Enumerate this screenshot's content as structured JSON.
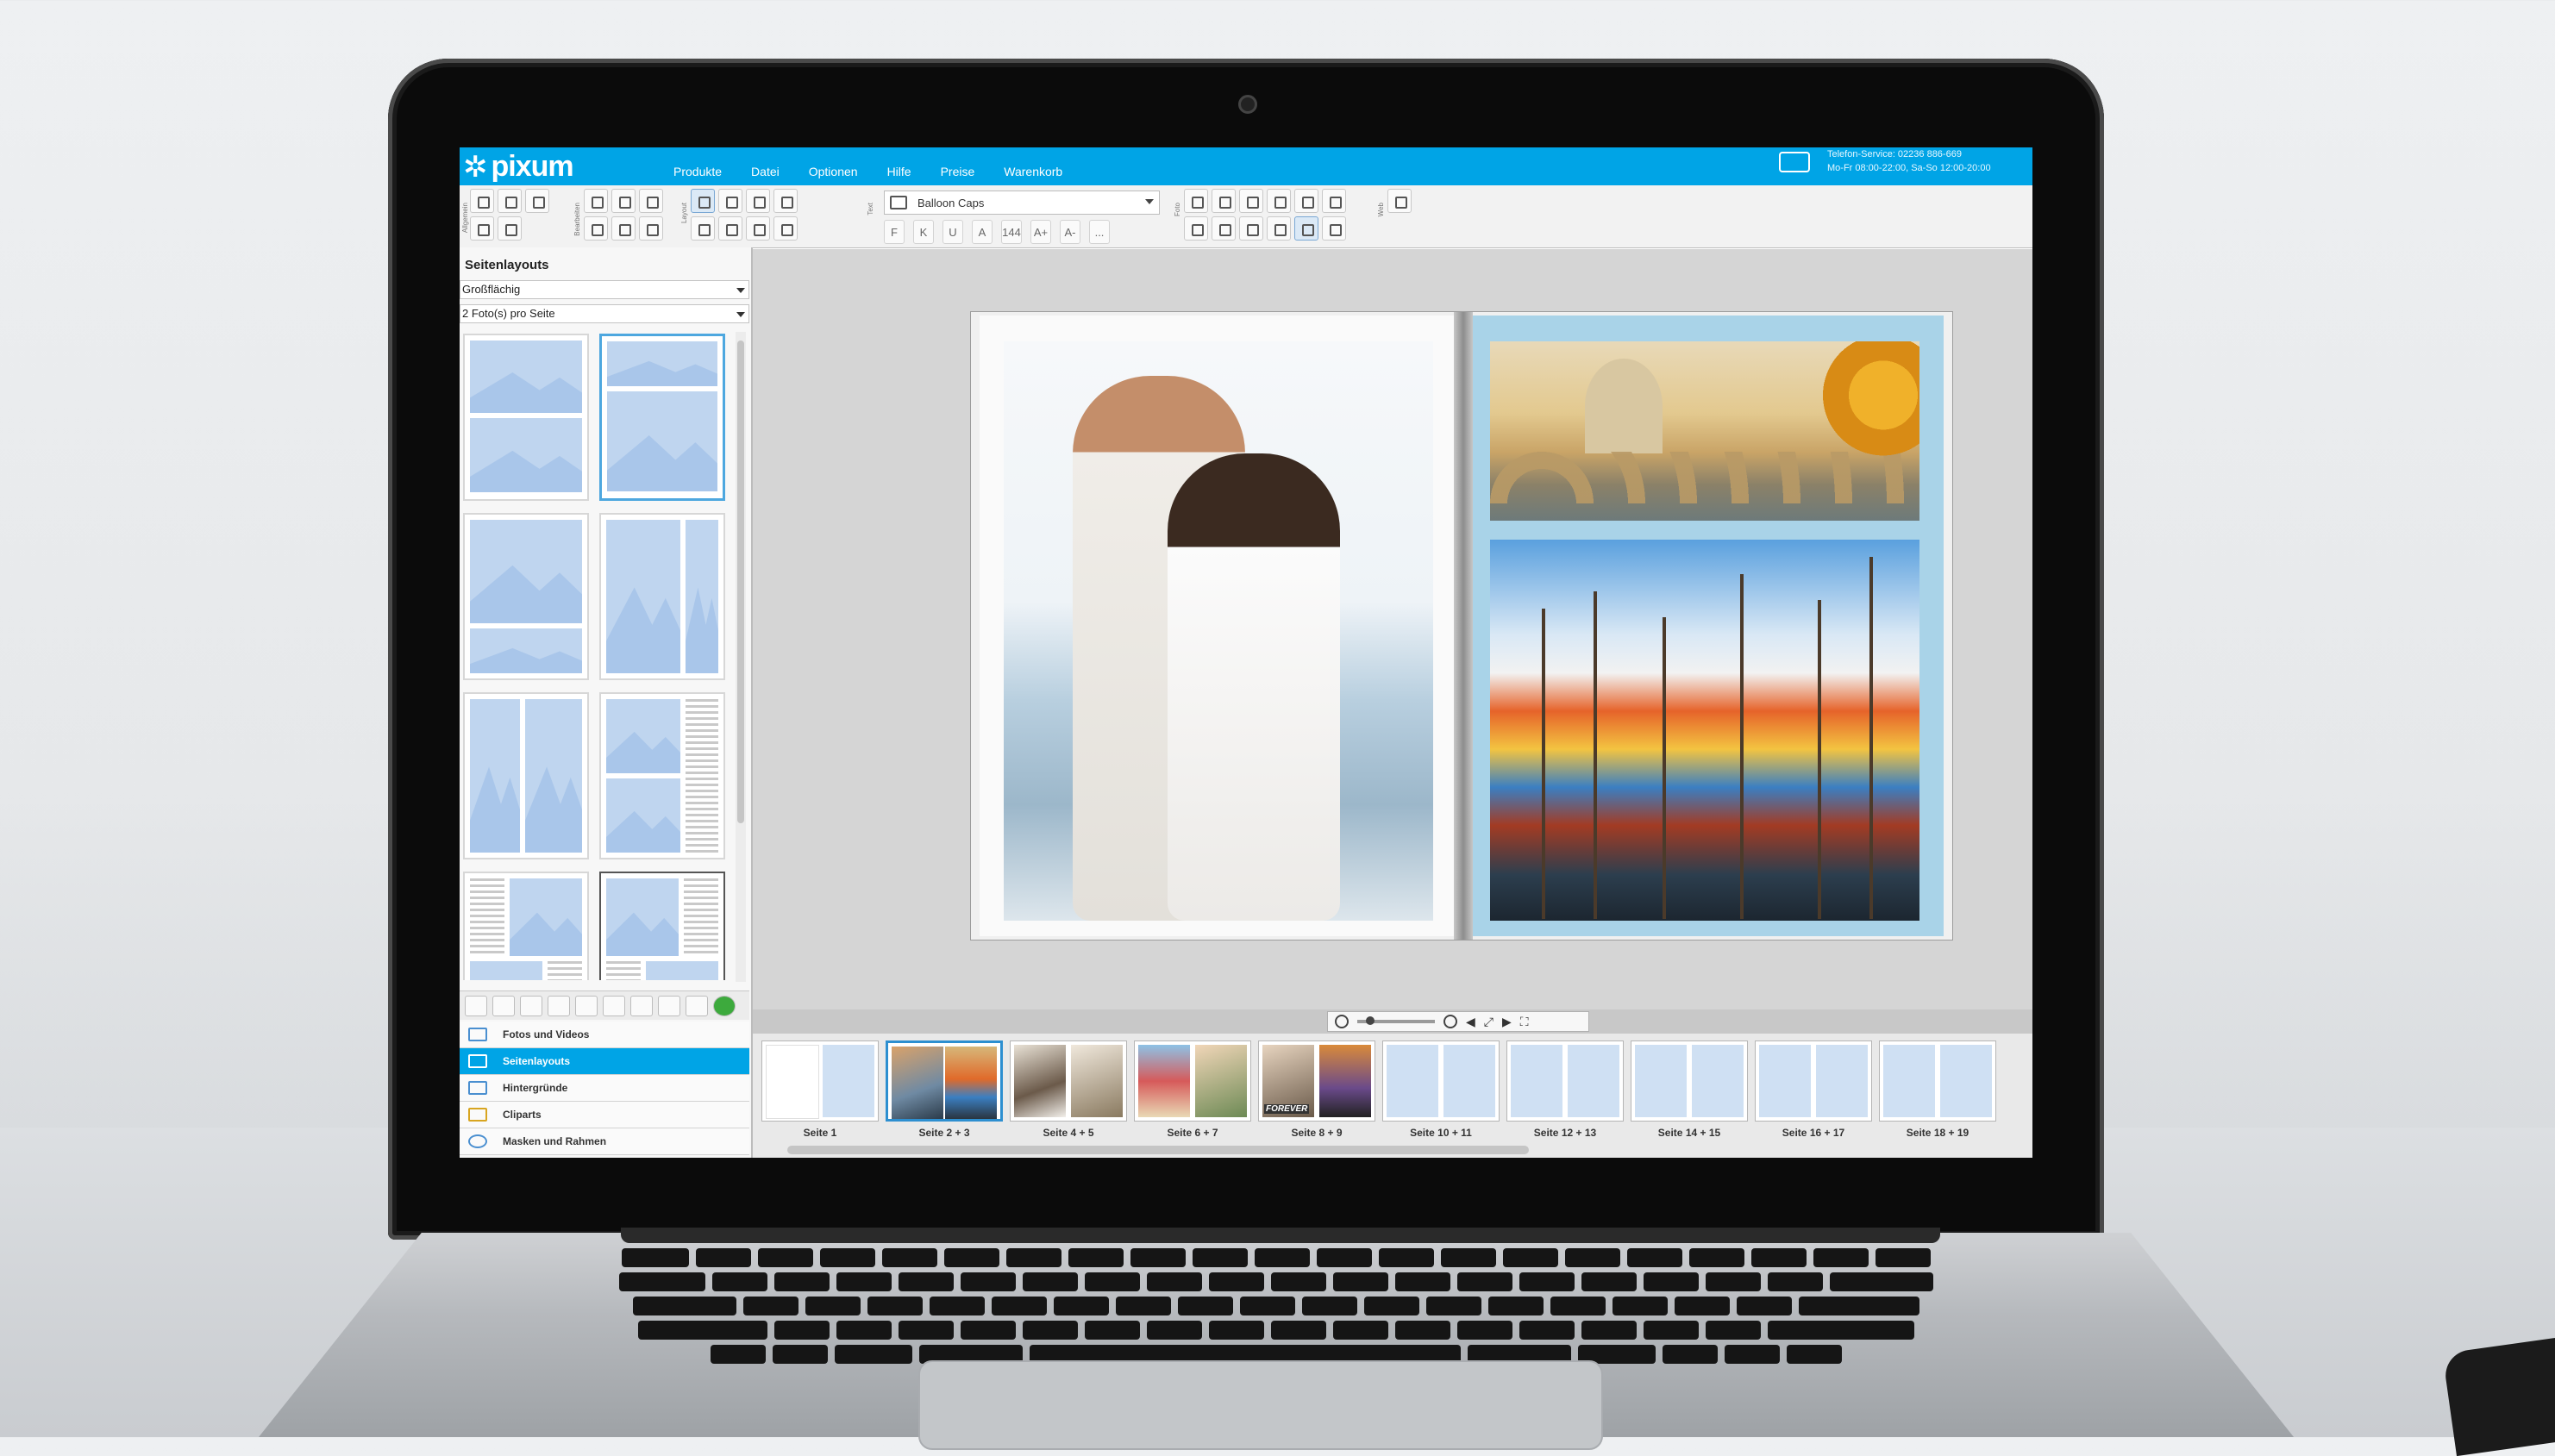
{
  "app": {
    "logo": "pixum"
  },
  "menu": [
    "Produkte",
    "Datei",
    "Optionen",
    "Hilfe",
    "Preise",
    "Warenkorb"
  ],
  "service": {
    "line1": "Telefon-Service: 02236 886-669",
    "line2": "Mo-Fr 08:00-22:00, Sa-So 12:00-20:00"
  },
  "toolbar": {
    "groups": [
      "Allgemein",
      "Bearbeiten",
      "Layout",
      "Text",
      "Foto",
      "Web"
    ],
    "font": "Balloon Caps",
    "text_tools": [
      "F",
      "K",
      "U",
      "A",
      "144",
      "A+",
      "A-",
      "..."
    ]
  },
  "left_panel": {
    "title": "Seitenlayouts",
    "select_style": "Großflächig",
    "select_count": "2 Foto(s) pro Seite"
  },
  "side_nav": [
    {
      "label": "Fotos und Videos",
      "icon": "photo-icon"
    },
    {
      "label": "Seitenlayouts",
      "icon": "layout-icon",
      "active": true
    },
    {
      "label": "Hintergründe",
      "icon": "background-icon"
    },
    {
      "label": "Cliparts",
      "icon": "clipart-icon"
    },
    {
      "label": "Masken und Rahmen",
      "icon": "heart-icon"
    }
  ],
  "pages": [
    "Seite 1",
    "Seite 2 + 3",
    "Seite 4 + 5",
    "Seite 6 + 7",
    "Seite 8 + 9",
    "Seite 10 + 11",
    "Seite 12 + 13",
    "Seite 14 + 15",
    "Seite 16 + 17",
    "Seite 18 + 19"
  ],
  "selected_page": "Seite 2 + 3",
  "thumbnail_text": "FOREVER",
  "colors": {
    "brand": "#00a4e6",
    "selection": "#2d8fd0"
  }
}
